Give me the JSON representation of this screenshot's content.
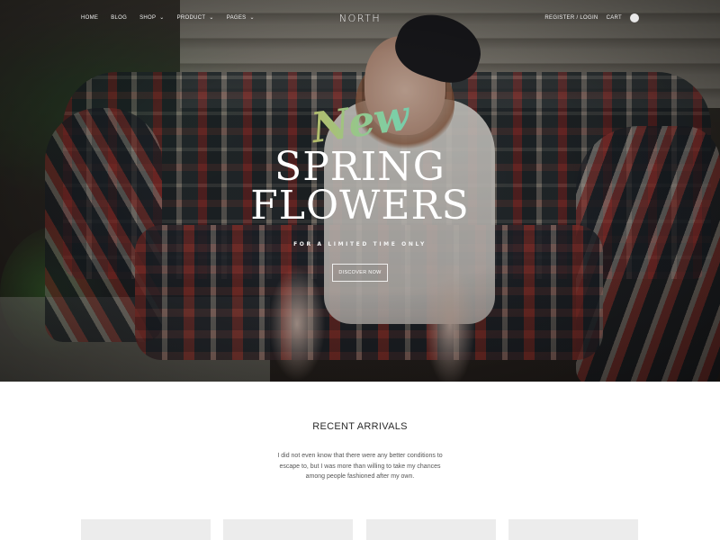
{
  "nav": {
    "left_items": [
      {
        "label": "HOME",
        "has_dropdown": false
      },
      {
        "label": "BLOG",
        "has_dropdown": false
      },
      {
        "label": "SHOP",
        "has_dropdown": true
      },
      {
        "label": "PRODUCT",
        "has_dropdown": true
      },
      {
        "label": "PAGES",
        "has_dropdown": true
      }
    ],
    "logo": "NORTH",
    "register_login": "REGISTER / LOGIN",
    "cart": "CART",
    "dropdown_glyph": "⌄"
  },
  "hero": {
    "script_word": "New",
    "headline_line1": "SPRING",
    "headline_line2": "FLOWERS",
    "tagline": "FOR A LIMITED TIME ONLY",
    "cta_label": "DISCOVER NOW"
  },
  "recent_arrivals": {
    "title": "RECENT ARRIVALS",
    "description_line1": "I did not even know that there were any better conditions to",
    "description_line2": "escape to, but I was more than willing to take my chances",
    "description_line3": "among people fashioned after my own."
  },
  "colors": {
    "background": "#ffffff",
    "product_placeholder": "#ececec",
    "hero_text": "#ffffff"
  },
  "icons": {
    "cart": "cart-icon",
    "dropdown": "chevron-down-icon"
  }
}
